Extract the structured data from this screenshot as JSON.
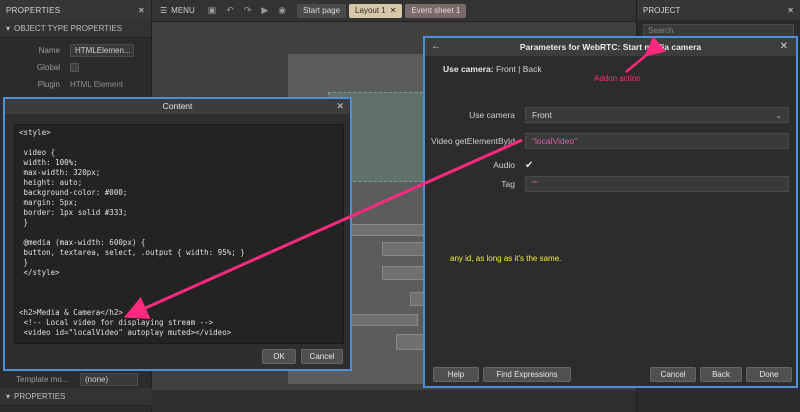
{
  "properties_panel": {
    "title": "PROPERTIES",
    "section_object_type": "OBJECT TYPE PROPERTIES",
    "rows": [
      {
        "label": "Name",
        "value": "HTMLElemen..."
      },
      {
        "label": "Global",
        "value": ""
      },
      {
        "label": "Plugin",
        "value": "HTML Element"
      }
    ],
    "template_mode_label": "Template mo...",
    "template_mode_value": "(none)",
    "bottom_section": "PROPERTIES"
  },
  "toolbar": {
    "menu_label": "MENU",
    "tabs": [
      {
        "label": "Start page"
      },
      {
        "label": "Layout 1"
      },
      {
        "label": "Event sheet 1"
      }
    ]
  },
  "project_panel": {
    "title": "PROJECT",
    "search_placeholder": "Search"
  },
  "content_dialog": {
    "title": "Content",
    "code_lines": [
      "<style>",
      "",
      " video {",
      " width: 100%;",
      " max-width: 320px;",
      " height: auto;",
      " background-color: #000;",
      " margin: 5px;",
      " border: 1px solid #333;",
      " }",
      "",
      " @media (max-width: 600px) {",
      " button, textarea, select, .output { width: 95%; }",
      " }",
      " </style>",
      "",
      "",
      "",
      "<h2>Media & Camera</h2>",
      " <!-- Local video for displaying stream -->",
      " <video id=\"localVideo\" autoplay muted></video>"
    ],
    "ok_label": "OK",
    "cancel_label": "Cancel"
  },
  "param_dialog": {
    "title": "Parameters for WebRTC: Start media camera",
    "summary_label": "Use camera:",
    "summary_value": "Front | Back",
    "params": [
      {
        "label": "Use camera",
        "value": "Front"
      },
      {
        "label": "Video getElementById",
        "value": "\"localVideo\""
      },
      {
        "label": "Audio",
        "value": "✔"
      },
      {
        "label": "Tag",
        "value": "\"\""
      }
    ],
    "buttons": {
      "help": "Help",
      "find_expressions": "Find Expressions",
      "cancel": "Cancel",
      "back": "Back",
      "done": "Done"
    }
  },
  "annotations": {
    "addon_action": "Addon action",
    "any_id_note": "any id, as long as it's the same."
  },
  "colors": {
    "accent_border": "#4d8fd8",
    "annotation_pink": "#ff2a7d",
    "annotation_yellow": "#f2ee3b",
    "string_value": "#e05aa6"
  }
}
